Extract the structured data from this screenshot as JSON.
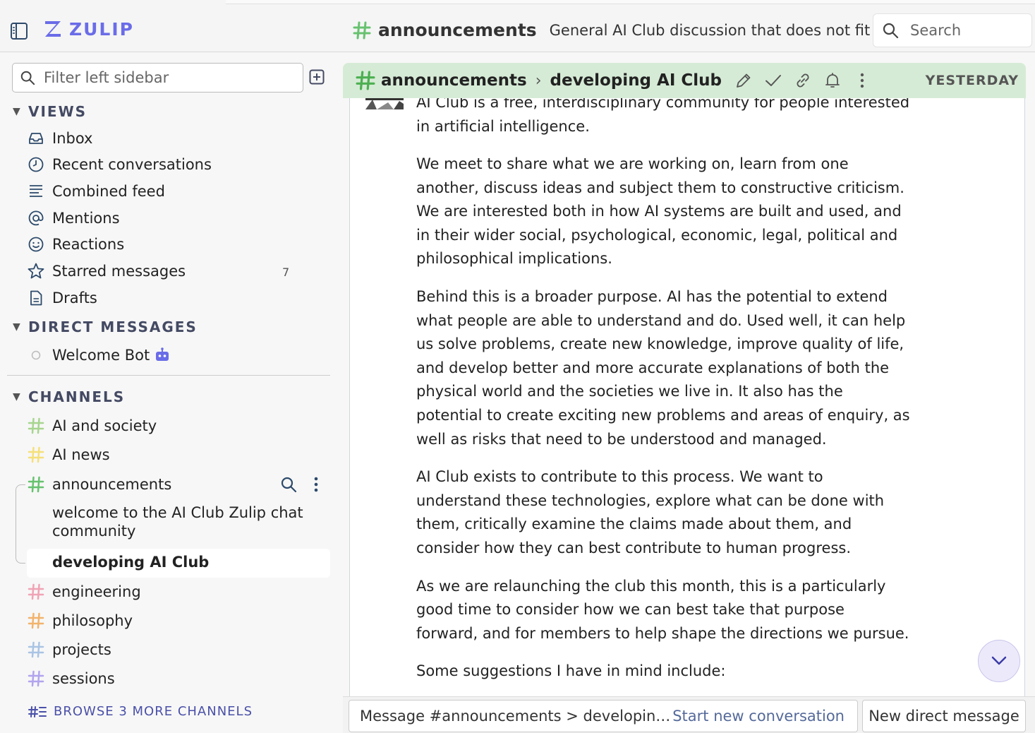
{
  "app": {
    "name": "ZULIP",
    "brand_color": "#6a6ce8"
  },
  "navbar": {
    "channel": "announcements",
    "description": "General AI Club discussion that does not fit n…",
    "search_placeholder": "Search"
  },
  "sidebar": {
    "filter_placeholder": "Filter left sidebar",
    "views_label": "VIEWS",
    "views": [
      {
        "label": "Inbox",
        "icon": "inbox-icon"
      },
      {
        "label": "Recent conversations",
        "icon": "clock-icon"
      },
      {
        "label": "Combined feed",
        "icon": "feed-icon"
      },
      {
        "label": "Mentions",
        "icon": "at-icon"
      },
      {
        "label": "Reactions",
        "icon": "smile-icon"
      },
      {
        "label": "Starred messages",
        "icon": "star-icon",
        "count": "7"
      },
      {
        "label": "Drafts",
        "icon": "drafts-icon"
      }
    ],
    "dm_label": "DIRECT MESSAGES",
    "dms": [
      {
        "label": "Welcome Bot"
      }
    ],
    "channels_label": "CHANNELS",
    "channels": [
      {
        "label": "AI and society",
        "color": "#a7d58f"
      },
      {
        "label": "AI news",
        "color": "#f5e07a"
      },
      {
        "label": "announcements",
        "color": "#67c26f"
      },
      {
        "label": "engineering",
        "color": "#f0a3b5"
      },
      {
        "label": "philosophy",
        "color": "#f2b36b"
      },
      {
        "label": "projects",
        "color": "#a9c4e4"
      },
      {
        "label": "sessions",
        "color": "#b2a4ee"
      }
    ],
    "topics": [
      {
        "label_line1": "welcome to the AI Club Zulip chat",
        "label_line2": "community"
      },
      {
        "label": "developing AI Club"
      }
    ],
    "browse_label": "BROWSE 3 MORE CHANNELS"
  },
  "recipient": {
    "channel": "announcements",
    "topic": "developing AI Club",
    "date": "YESTERDAY",
    "color": "#d6ebd6"
  },
  "message": {
    "paragraphs": [
      "AI Club is a free, interdisciplinary community for people interested in artificial intelligence.",
      "We meet to share what we are working on, learn from one another, discuss ideas and subject them to constructive criticism. We are interested both in how AI systems are built and used, and in their wider social, psychological, economic, legal, political and philosophical implications.",
      "Behind this is a broader purpose. AI has the potential to extend what people are able to understand and do. Used well, it can help us solve problems, create new knowledge, improve quality of life, and develop better and more accurate explanations of both the physical world and the societies we live in. It also has the potential to create exciting new problems and areas of enquiry, as well as risks that need to be understood and managed.",
      "AI Club exists to contribute to this process. We want to understand these technologies, explore what can be done with them, critically examine the claims made about them, and consider how they can best contribute to human progress.",
      "As we are relaunching the club this month, this is a particularly good time to consider how we can best take that purpose forward, and for members to help shape the directions we pursue.",
      "Some suggestions I have in mind include:"
    ]
  },
  "compose": {
    "message_label": "Message #announcements > developin…",
    "new_conversation": "Start new conversation",
    "new_dm": "New direct message"
  }
}
